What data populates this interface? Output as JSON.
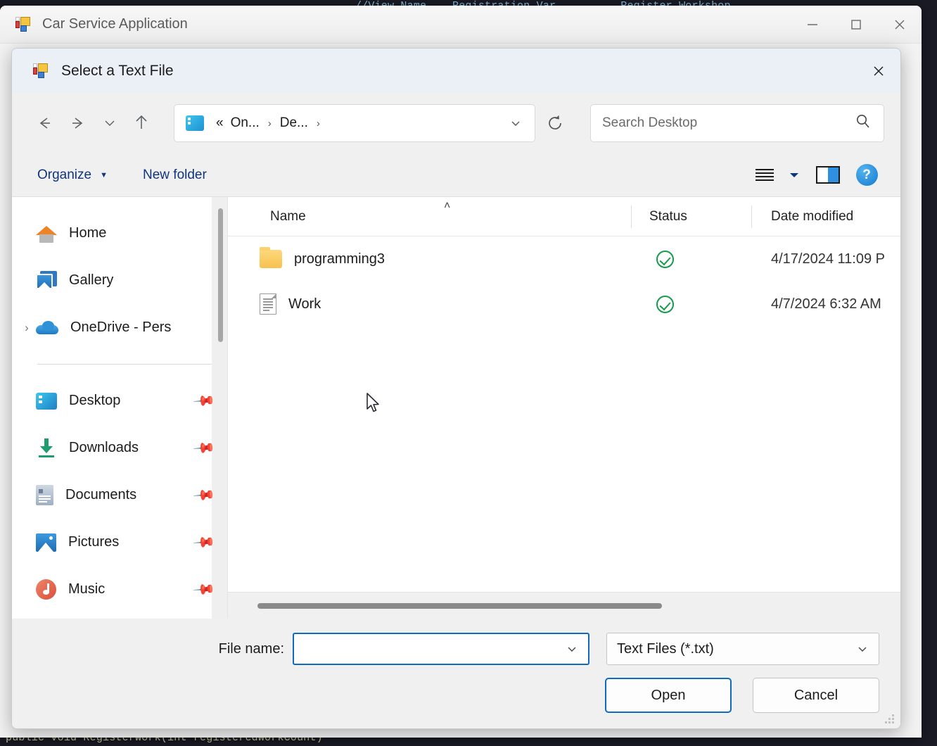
{
  "background": {
    "code_top": "//View Name    Registration Var          Register Workshop",
    "code_bottom": "public void RegisterWork(int registeredWorkCount)"
  },
  "app_window": {
    "title": "Car Service Application",
    "icon": "winforms-app-icon",
    "controls": {
      "minimize": "—",
      "maximize": "□",
      "close": "✕"
    }
  },
  "dialog": {
    "title": "Select a Text File",
    "icon": "winforms-app-icon",
    "close": "✕",
    "nav": {
      "back": "←",
      "forward": "→",
      "recent": "⌄",
      "up": "↑",
      "refresh_title": "Refresh",
      "breadcrumbs": [
        {
          "label": "«",
          "sep": ""
        },
        {
          "label": "On...",
          "sep": "›"
        },
        {
          "label": "De...",
          "sep": "›"
        }
      ],
      "address_dropdown": "⌄"
    },
    "search": {
      "placeholder": "Search Desktop",
      "value": "",
      "icon": "search-icon"
    },
    "command_bar": {
      "organize": "Organize",
      "organize_caret": "▼",
      "new_folder": "New folder",
      "view_icon": "view-list-icon",
      "view_caret": "▼",
      "pane_icon": "preview-pane-icon",
      "help": "?"
    },
    "sidebar": {
      "groups": [
        {
          "items": [
            {
              "label": "Home",
              "icon": "home-icon",
              "expander": "",
              "pin": ""
            },
            {
              "label": "Gallery",
              "icon": "gallery-icon",
              "expander": "",
              "pin": ""
            },
            {
              "label": "OneDrive - Pers",
              "icon": "onedrive-cloud-icon",
              "expander": "›",
              "pin": ""
            }
          ]
        },
        {
          "items": [
            {
              "label": "Desktop",
              "icon": "desktop-icon",
              "expander": "",
              "pin": "📌"
            },
            {
              "label": "Downloads",
              "icon": "downloads-icon",
              "expander": "",
              "pin": "📌"
            },
            {
              "label": "Documents",
              "icon": "documents-icon",
              "expander": "",
              "pin": "📌"
            },
            {
              "label": "Pictures",
              "icon": "pictures-icon",
              "expander": "",
              "pin": "📌"
            },
            {
              "label": "Music",
              "icon": "music-icon",
              "expander": "",
              "pin": "📌"
            }
          ]
        }
      ]
    },
    "file_list": {
      "columns": {
        "name": "Name",
        "status": "Status",
        "date_modified": "Date modified"
      },
      "sort_caret": "˄",
      "rows": [
        {
          "name": "programming3",
          "icon": "folder-icon",
          "status": "synced",
          "date_modified": "4/17/2024 11:09 P"
        },
        {
          "name": "Work",
          "icon": "text-file-icon",
          "status": "synced",
          "date_modified": "4/7/2024 6:32 AM"
        }
      ]
    },
    "footer": {
      "file_name_label": "File name:",
      "file_name_value": "",
      "file_name_chevron": "⌄",
      "filter_value": "Text Files (*.txt)",
      "filter_chevron": "⌄",
      "open_button": "Open",
      "cancel_button": "Cancel"
    }
  },
  "colors": {
    "accent": "#0f6cbd",
    "link": "#11357a",
    "status_ok": "#169b4a",
    "dialog_titlebar": "#eaf0f5"
  }
}
